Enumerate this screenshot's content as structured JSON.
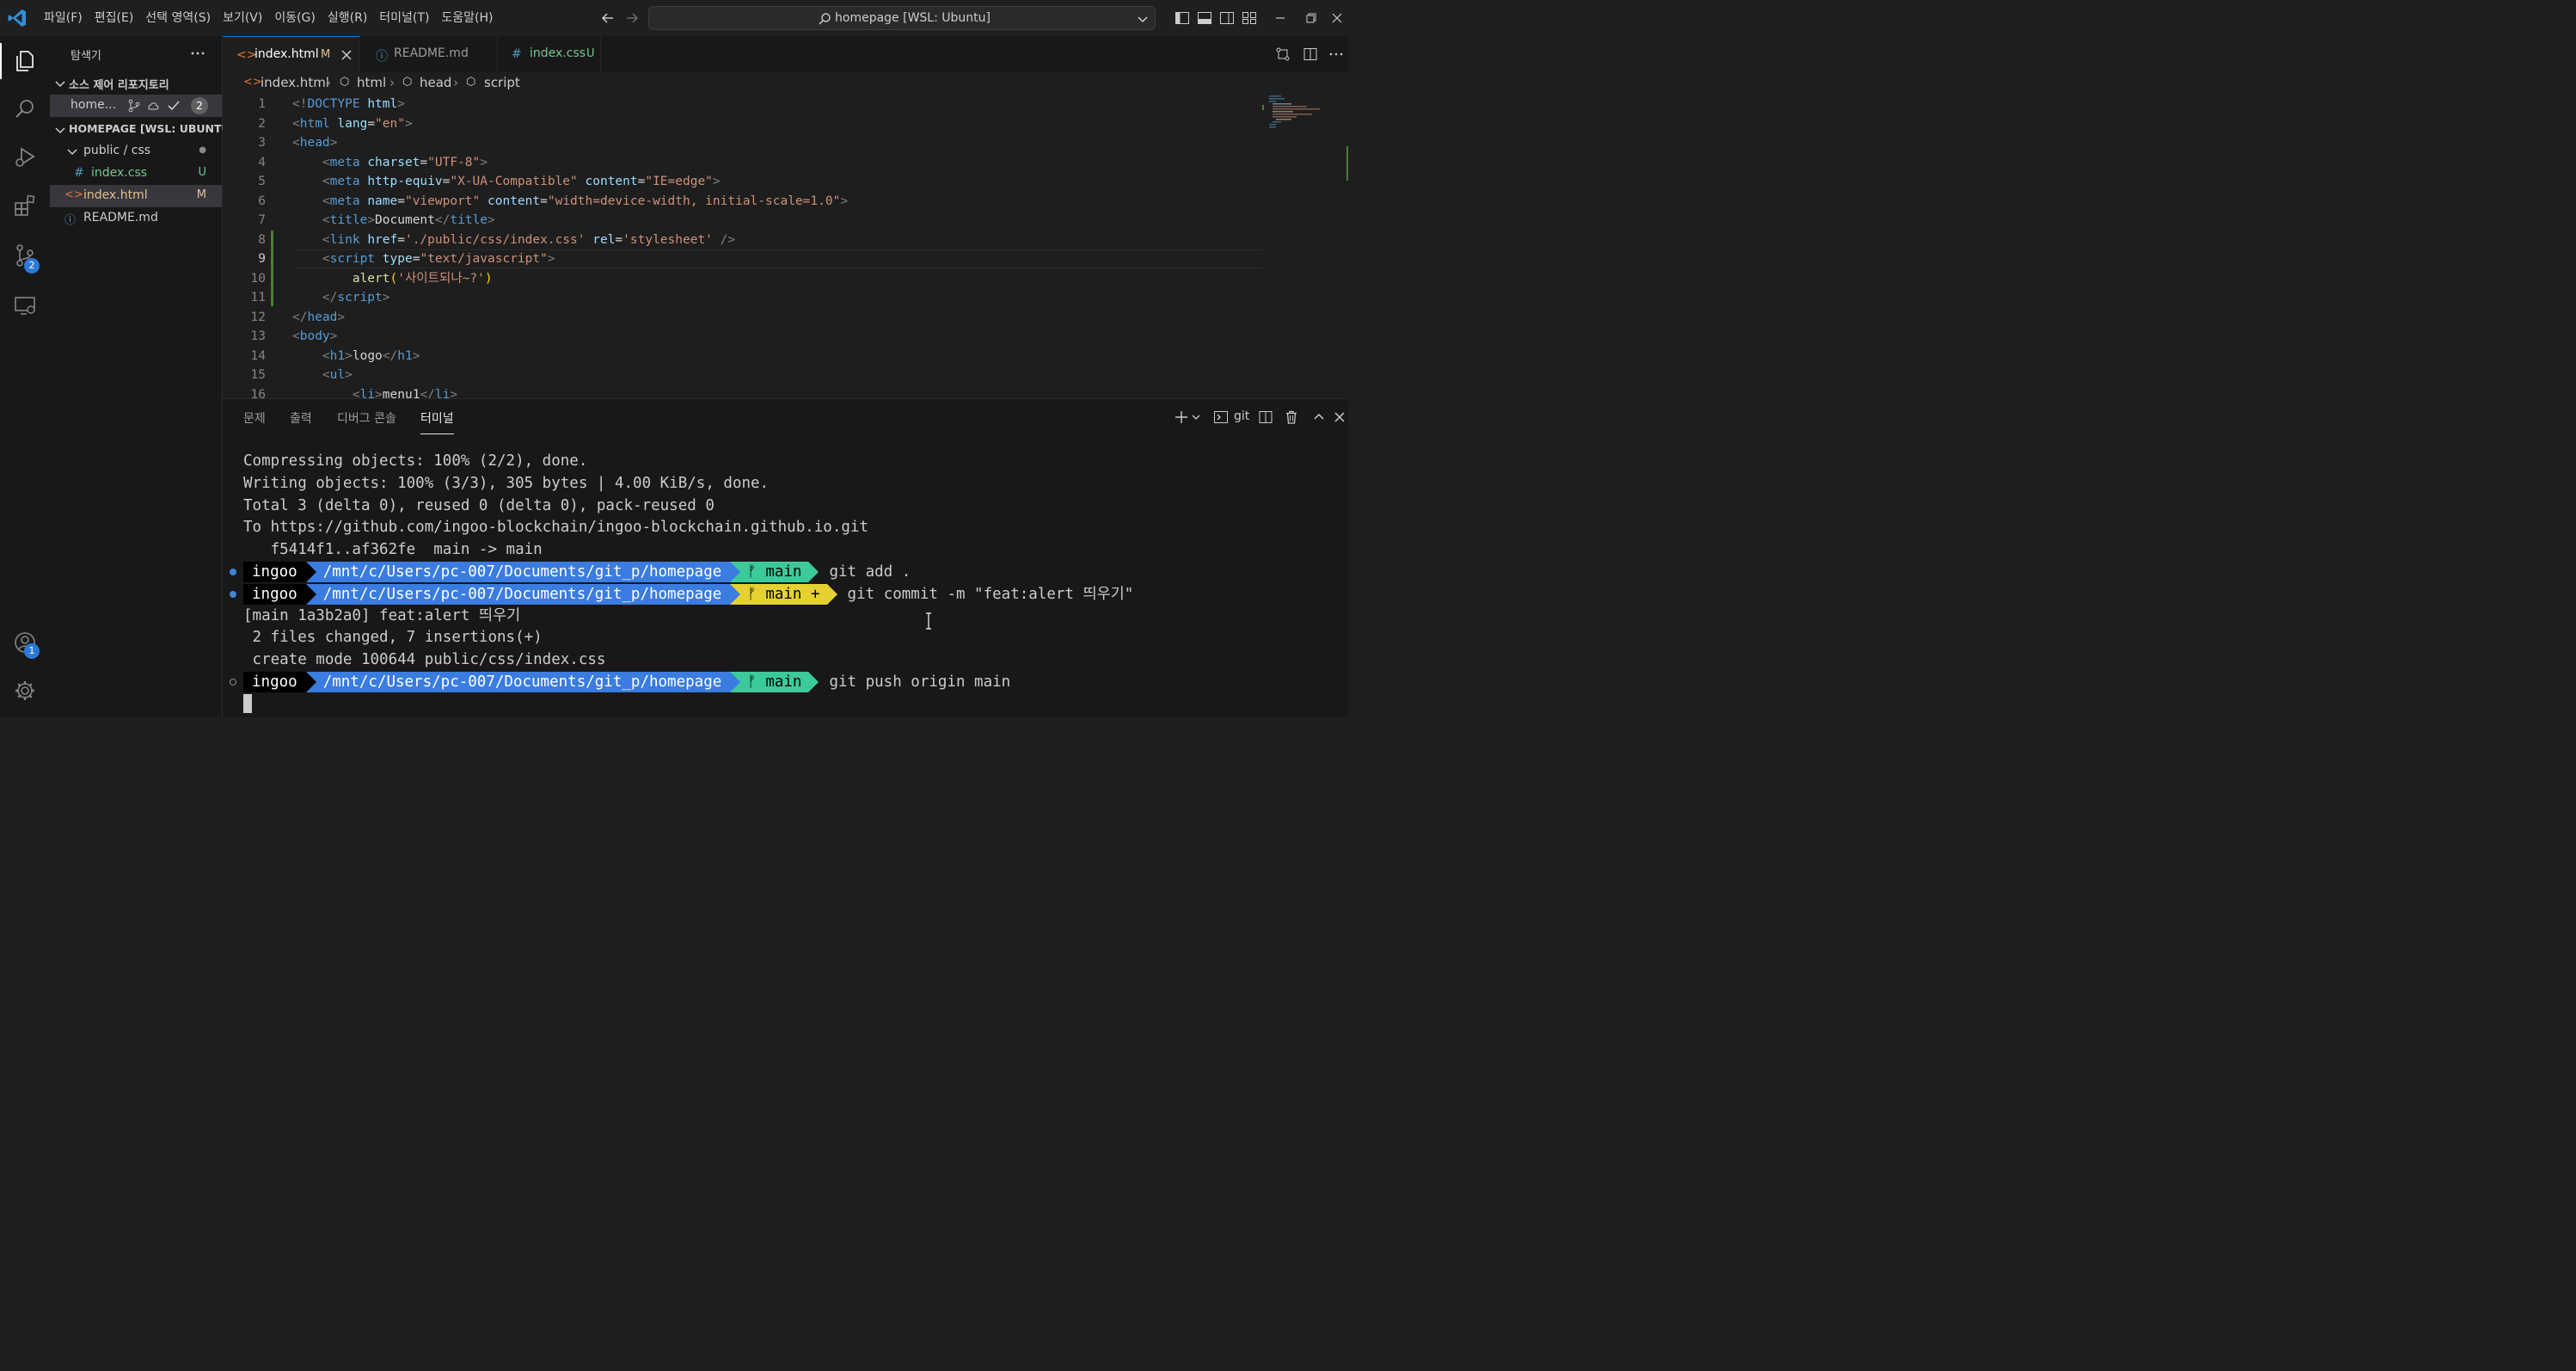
{
  "menubar": {
    "items": [
      "파일(F)",
      "편집(E)",
      "선택 영역(S)",
      "보기(V)",
      "이동(G)",
      "실행(R)",
      "터미널(T)",
      "도움말(H)"
    ]
  },
  "command_center": {
    "text": "homepage [WSL: Ubuntu]"
  },
  "activity_bar": {
    "source_control_badge": "2",
    "accounts_badge": "1"
  },
  "sidebar": {
    "title": "탐색기",
    "scm_section": "소스 제어 리포지토리",
    "scm_repo": {
      "name": "home...",
      "count": "2"
    },
    "folder_section": "HOMEPAGE [WSL: UBUNTU]",
    "tree": [
      {
        "label": "public / css",
        "deco": "●"
      },
      {
        "label": "index.css",
        "deco": "U",
        "icon": "#"
      },
      {
        "label": "index.html",
        "deco": "M",
        "icon": "<>"
      },
      {
        "label": "README.md",
        "deco": "",
        "icon": "ⓘ"
      }
    ]
  },
  "tabs": [
    {
      "label": "index.html",
      "deco": "M",
      "icon": "<>"
    },
    {
      "label": "README.md",
      "deco": "",
      "icon": "ⓘ"
    },
    {
      "label": "index.css",
      "deco": "U",
      "icon": "#"
    }
  ],
  "breadcrumb": [
    "index.html",
    "html",
    "head",
    "script"
  ],
  "editor": {
    "current_line": 9,
    "line_numbers": [
      "1",
      "2",
      "3",
      "4",
      "5",
      "6",
      "7",
      "8",
      "9",
      "10",
      "11",
      "12",
      "13",
      "14",
      "15",
      "16"
    ],
    "lines": [
      [
        [
          "<!",
          "punc"
        ],
        [
          "DOCTYPE",
          "tag"
        ],
        [
          " ",
          "text"
        ],
        [
          "html",
          "attr"
        ],
        [
          ">",
          "punc"
        ]
      ],
      [
        [
          "<",
          "punc"
        ],
        [
          "html",
          "tag"
        ],
        [
          " ",
          "text"
        ],
        [
          "lang",
          "attr"
        ],
        [
          "=",
          "text"
        ],
        [
          "\"en\"",
          "str"
        ],
        [
          ">",
          "punc"
        ]
      ],
      [
        [
          "<",
          "punc"
        ],
        [
          "head",
          "tag"
        ],
        [
          ">",
          "punc"
        ]
      ],
      [
        [
          "    ",
          "text"
        ],
        [
          "<",
          "punc"
        ],
        [
          "meta",
          "tag"
        ],
        [
          " ",
          "text"
        ],
        [
          "charset",
          "attr"
        ],
        [
          "=",
          "text"
        ],
        [
          "\"UTF-8\"",
          "str"
        ],
        [
          ">",
          "punc"
        ]
      ],
      [
        [
          "    ",
          "text"
        ],
        [
          "<",
          "punc"
        ],
        [
          "meta",
          "tag"
        ],
        [
          " ",
          "text"
        ],
        [
          "http-equiv",
          "attr"
        ],
        [
          "=",
          "text"
        ],
        [
          "\"X-UA-Compatible\"",
          "str"
        ],
        [
          " ",
          "text"
        ],
        [
          "content",
          "attr"
        ],
        [
          "=",
          "text"
        ],
        [
          "\"IE=edge\"",
          "str"
        ],
        [
          ">",
          "punc"
        ]
      ],
      [
        [
          "    ",
          "text"
        ],
        [
          "<",
          "punc"
        ],
        [
          "meta",
          "tag"
        ],
        [
          " ",
          "text"
        ],
        [
          "name",
          "attr"
        ],
        [
          "=",
          "text"
        ],
        [
          "\"viewport\"",
          "str"
        ],
        [
          " ",
          "text"
        ],
        [
          "content",
          "attr"
        ],
        [
          "=",
          "text"
        ],
        [
          "\"width=device-width, initial-scale=1.0\"",
          "str"
        ],
        [
          ">",
          "punc"
        ]
      ],
      [
        [
          "    ",
          "text"
        ],
        [
          "<",
          "punc"
        ],
        [
          "title",
          "tag"
        ],
        [
          ">",
          "punc"
        ],
        [
          "Document",
          "text"
        ],
        [
          "</",
          "punc"
        ],
        [
          "title",
          "tag"
        ],
        [
          ">",
          "punc"
        ]
      ],
      [
        [
          "    ",
          "text"
        ],
        [
          "<",
          "punc"
        ],
        [
          "link",
          "tag"
        ],
        [
          " ",
          "text"
        ],
        [
          "href",
          "attr"
        ],
        [
          "=",
          "text"
        ],
        [
          "'./public/css/index.css'",
          "str"
        ],
        [
          " ",
          "text"
        ],
        [
          "rel",
          "attr"
        ],
        [
          "=",
          "text"
        ],
        [
          "'stylesheet'",
          "str"
        ],
        [
          " />",
          "punc"
        ]
      ],
      [
        [
          "    ",
          "text"
        ],
        [
          "<",
          "punc"
        ],
        [
          "script",
          "tag"
        ],
        [
          " ",
          "text"
        ],
        [
          "type",
          "attr"
        ],
        [
          "=",
          "text"
        ],
        [
          "\"text/javascript\"",
          "str"
        ],
        [
          ">",
          "punc"
        ]
      ],
      [
        [
          "        ",
          "text"
        ],
        [
          "alert",
          "fn"
        ],
        [
          "(",
          "paren"
        ],
        [
          "'사이트되나~?'",
          "str"
        ],
        [
          ")",
          "paren"
        ]
      ],
      [
        [
          "    ",
          "text"
        ],
        [
          "</",
          "punc"
        ],
        [
          "script",
          "tag"
        ],
        [
          ">",
          "punc"
        ]
      ],
      [
        [
          "</",
          "punc"
        ],
        [
          "head",
          "tag"
        ],
        [
          ">",
          "punc"
        ]
      ],
      [
        [
          "<",
          "punc"
        ],
        [
          "body",
          "tag"
        ],
        [
          ">",
          "punc"
        ]
      ],
      [
        [
          "    ",
          "text"
        ],
        [
          "<",
          "punc"
        ],
        [
          "h1",
          "tag"
        ],
        [
          ">",
          "punc"
        ],
        [
          "logo",
          "text"
        ],
        [
          "</",
          "punc"
        ],
        [
          "h1",
          "tag"
        ],
        [
          ">",
          "punc"
        ]
      ],
      [
        [
          "    ",
          "text"
        ],
        [
          "<",
          "punc"
        ],
        [
          "ul",
          "tag"
        ],
        [
          ">",
          "punc"
        ]
      ],
      [
        [
          "        ",
          "text"
        ],
        [
          "<",
          "punc"
        ],
        [
          "li",
          "tag"
        ],
        [
          ">",
          "punc"
        ],
        [
          "menu1",
          "text"
        ],
        [
          "</",
          "punc"
        ],
        [
          "li",
          "tag"
        ],
        [
          ">",
          "punc"
        ]
      ]
    ]
  },
  "panel": {
    "tabs": [
      "문제",
      "출력",
      "디버그 콘솔",
      "터미널"
    ],
    "active_tab": 3,
    "terminal_profile": "git"
  },
  "terminal": {
    "lines": [
      "Compressing objects: 100% (2/2), done.",
      "Writing objects: 100% (3/3), 305 bytes | 4.00 KiB/s, done.",
      "Total 3 (delta 0), reused 0 (delta 0), pack-reused 0",
      "To https://github.com/ingoo-blockchain/ingoo-blockchain.github.io.git",
      "   f5414f1..af362fe  main -> main"
    ],
    "prompts": [
      {
        "user": "ingoo",
        "path": "/mnt/c/Users/pc-007/Documents/git_p/homepage",
        "branch": "ᚠ main",
        "cmd": "git add .",
        "git_color": "#3cc99b",
        "dot": "filled"
      },
      {
        "user": "ingoo",
        "path": "/mnt/c/Users/pc-007/Documents/git_p/homepage",
        "branch": "ᚠ main +",
        "cmd": "git commit -m \"feat:alert 띄우기\"",
        "git_color": "#e5d232",
        "dot": "filled"
      }
    ],
    "output_lines": [
      "[main 1a3b2a0] feat:alert 띄우기",
      " 2 files changed, 7 insertions(+)",
      " create mode 100644 public/css/index.css"
    ],
    "last_prompt": {
      "user": "ingoo",
      "path": "/mnt/c/Users/pc-007/Documents/git_p/homepage",
      "branch": "ᚠ main",
      "cmd": "git push origin main",
      "git_color": "#3cc99b",
      "dot": "hollow"
    }
  },
  "colors": {
    "accent": "#0078d4",
    "modified": "#e2c08d",
    "untracked": "#73c991",
    "badge": "#2c7ad6"
  }
}
